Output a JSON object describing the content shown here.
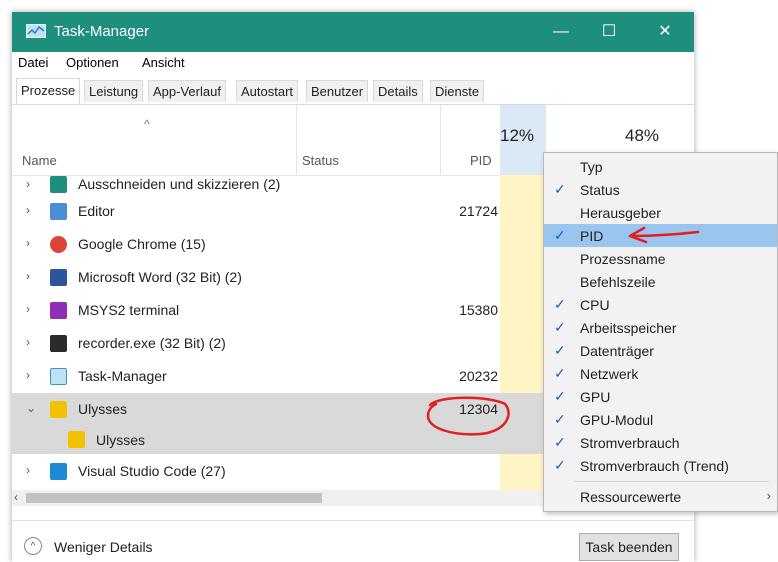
{
  "window": {
    "title": "Task-Manager",
    "minimize": "—",
    "maximize": "☐",
    "close": "✕"
  },
  "menu": [
    "Datei",
    "Optionen",
    "Ansicht"
  ],
  "tabs": [
    "Prozesse",
    "Leistung",
    "App-Verlauf",
    "Autostart",
    "Benutzer",
    "Details",
    "Dienste"
  ],
  "header": {
    "name": "Name",
    "status": "Status",
    "pid": "PID",
    "cpu_pct": "12%",
    "mem_pct": "48%",
    "sort_arrow": "^"
  },
  "rows": [
    {
      "expander": "›",
      "icon": "snip-icon",
      "color": "#1e8f7d",
      "name": "Ausschneiden und skizzieren (2)",
      "pid": ""
    },
    {
      "expander": "›",
      "icon": "notepad-icon",
      "color": "#4a8fd6",
      "name": "Editor",
      "pid": "21724"
    },
    {
      "expander": "›",
      "icon": "chrome-icon",
      "color": "#db4437",
      "name": "Google Chrome (15)",
      "pid": ""
    },
    {
      "expander": "›",
      "icon": "word-icon",
      "color": "#2b579a",
      "name": "Microsoft Word (32 Bit) (2)",
      "pid": ""
    },
    {
      "expander": "›",
      "icon": "msys2-icon",
      "color": "#8e2fb6",
      "name": "MSYS2 terminal",
      "pid": "15380"
    },
    {
      "expander": "›",
      "icon": "recorder-icon",
      "color": "#2b2b2b",
      "name": "recorder.exe (32 Bit) (2)",
      "pid": ""
    },
    {
      "expander": "›",
      "icon": "taskmanager-icon",
      "color": "#4a8fd6",
      "name": "Task-Manager",
      "pid": "20232"
    },
    {
      "expander": "⌄",
      "icon": "ulysses-icon",
      "color": "#f2c200",
      "name": "Ulysses",
      "pid": "12304"
    },
    {
      "expander": "",
      "icon": "ulysses-icon",
      "color": "#f2c200",
      "name": "Ulysses",
      "pid": ""
    },
    {
      "expander": "›",
      "icon": "vscode-icon",
      "color": "#1f8ad2",
      "name": "Visual Studio Code (27)",
      "pid": ""
    }
  ],
  "scroll_left": "‹",
  "footer": {
    "less_details": "Weniger Details",
    "end_task": "Task beenden",
    "collapse_glyph": "^"
  },
  "context_menu": {
    "items": [
      {
        "label": "Typ",
        "checked": false
      },
      {
        "label": "Status",
        "checked": true
      },
      {
        "label": "Herausgeber",
        "checked": false
      },
      {
        "label": "PID",
        "checked": true
      },
      {
        "label": "Prozessname",
        "checked": false
      },
      {
        "label": "Befehlszeile",
        "checked": false
      },
      {
        "label": "CPU",
        "checked": true
      },
      {
        "label": "Arbeitsspeicher",
        "checked": true
      },
      {
        "label": "Datenträger",
        "checked": true
      },
      {
        "label": "Netzwerk",
        "checked": true
      },
      {
        "label": "GPU",
        "checked": true
      },
      {
        "label": "GPU-Modul",
        "checked": true
      },
      {
        "label": "Stromverbrauch",
        "checked": true
      },
      {
        "label": "Stromverbrauch (Trend)",
        "checked": true
      }
    ],
    "submenu": {
      "label": "Ressourcewerte",
      "arrow": "›"
    },
    "check_glyph": "✓"
  },
  "colors": {
    "accent": "#1e8f7d",
    "highlight": "#99c5ef",
    "cpu_column": "#fff4c4",
    "annotation": "#e02020"
  }
}
